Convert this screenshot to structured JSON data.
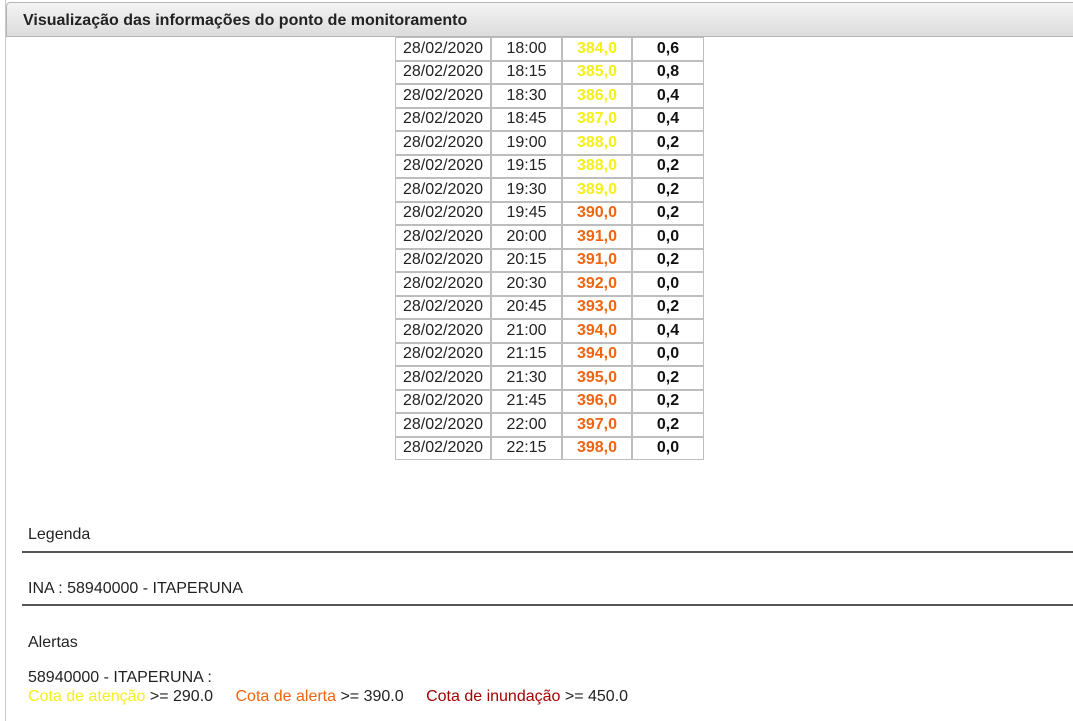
{
  "panel": {
    "title": "Visualização das informações do ponto de monitoramento"
  },
  "colors": {
    "attention": "#f5ef1a",
    "alert": "#f06410",
    "flood": "#a40000"
  },
  "table": {
    "rows": [
      {
        "date": "28/02/2020",
        "time": "18:00",
        "level": "384,0",
        "level_status": "attention",
        "rain": "0,6"
      },
      {
        "date": "28/02/2020",
        "time": "18:15",
        "level": "385,0",
        "level_status": "attention",
        "rain": "0,8"
      },
      {
        "date": "28/02/2020",
        "time": "18:30",
        "level": "386,0",
        "level_status": "attention",
        "rain": "0,4"
      },
      {
        "date": "28/02/2020",
        "time": "18:45",
        "level": "387,0",
        "level_status": "attention",
        "rain": "0,4"
      },
      {
        "date": "28/02/2020",
        "time": "19:00",
        "level": "388,0",
        "level_status": "attention",
        "rain": "0,2"
      },
      {
        "date": "28/02/2020",
        "time": "19:15",
        "level": "388,0",
        "level_status": "attention",
        "rain": "0,2"
      },
      {
        "date": "28/02/2020",
        "time": "19:30",
        "level": "389,0",
        "level_status": "attention",
        "rain": "0,2"
      },
      {
        "date": "28/02/2020",
        "time": "19:45",
        "level": "390,0",
        "level_status": "alert",
        "rain": "0,2"
      },
      {
        "date": "28/02/2020",
        "time": "20:00",
        "level": "391,0",
        "level_status": "alert",
        "rain": "0,0"
      },
      {
        "date": "28/02/2020",
        "time": "20:15",
        "level": "391,0",
        "level_status": "alert",
        "rain": "0,2"
      },
      {
        "date": "28/02/2020",
        "time": "20:30",
        "level": "392,0",
        "level_status": "alert",
        "rain": "0,0"
      },
      {
        "date": "28/02/2020",
        "time": "20:45",
        "level": "393,0",
        "level_status": "alert",
        "rain": "0,2"
      },
      {
        "date": "28/02/2020",
        "time": "21:00",
        "level": "394,0",
        "level_status": "alert",
        "rain": "0,4"
      },
      {
        "date": "28/02/2020",
        "time": "21:15",
        "level": "394,0",
        "level_status": "alert",
        "rain": "0,0"
      },
      {
        "date": "28/02/2020",
        "time": "21:30",
        "level": "395,0",
        "level_status": "alert",
        "rain": "0,2"
      },
      {
        "date": "28/02/2020",
        "time": "21:45",
        "level": "396,0",
        "level_status": "alert",
        "rain": "0,2"
      },
      {
        "date": "28/02/2020",
        "time": "22:00",
        "level": "397,0",
        "level_status": "alert",
        "rain": "0,2"
      },
      {
        "date": "28/02/2020",
        "time": "22:15",
        "level": "398,0",
        "level_status": "alert",
        "rain": "0,0"
      }
    ]
  },
  "legend": {
    "heading": "Legenda",
    "station": "INA : 58940000 - ITAPERUNA"
  },
  "alerts": {
    "heading": "Alertas",
    "station": "58940000 - ITAPERUNA :",
    "attention_label": "Cota de atenção",
    "attention_value": " >= 290.0",
    "alert_label": "Cota de alerta",
    "alert_value": " >= 390.0",
    "flood_label": "Cota de inundação",
    "flood_value": " >= 450.0"
  }
}
